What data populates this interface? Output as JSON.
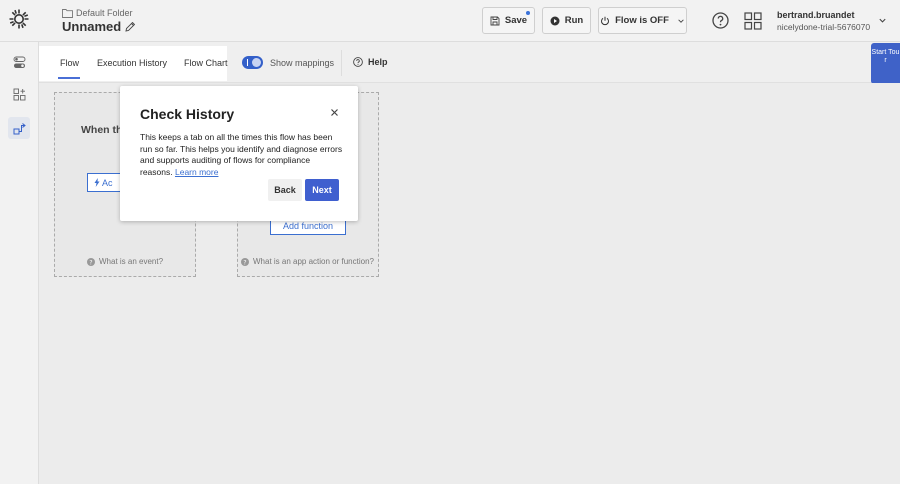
{
  "header": {
    "folder": "Default Folder",
    "flow_name": "Unnamed",
    "save_label": "Save",
    "run_label": "Run",
    "flow_status_label": "Flow is OFF",
    "user_name": "bertrand.bruandet",
    "user_org": "nicelydone-trial-5676070"
  },
  "tabs": {
    "flow": "Flow",
    "execution_history": "Execution History",
    "flow_chart": "Flow Chart",
    "show_mappings": "Show mappings",
    "help": "Help"
  },
  "start_tour": "Start Tour",
  "canvas": {
    "event_heading": "When th",
    "add_event_label": "Ac",
    "add_function_label": "Add function",
    "hint_event": "What is an event?",
    "hint_action": "What is an app action or function?"
  },
  "popover": {
    "title": "Check History",
    "body": "This keeps a tab on all the times this flow has been run so far. This helps you identify and diagnose errors and supports auditing of flows for compliance reasons.",
    "learn_more": "Learn more",
    "back_label": "Back",
    "next_label": "Next"
  },
  "colors": {
    "accent": "#3f5fcf",
    "link": "#3b6fd0",
    "toggle": "#3460c9"
  }
}
